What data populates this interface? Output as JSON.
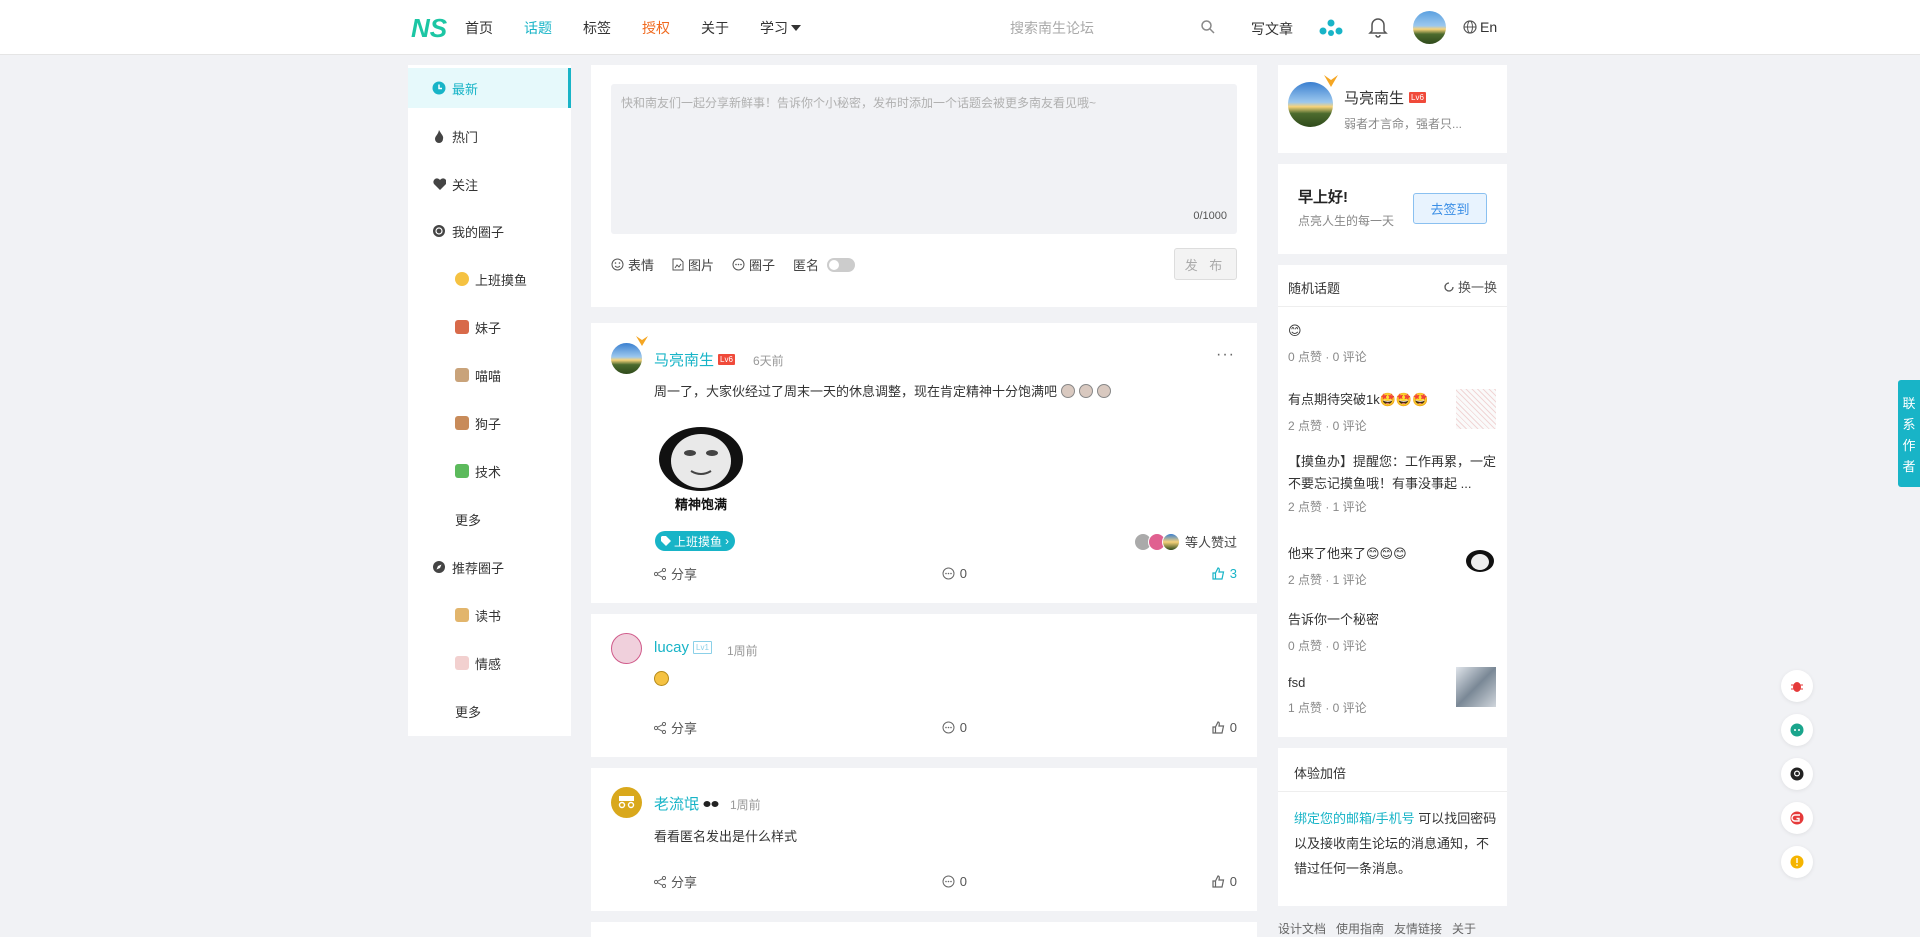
{
  "header": {
    "nav": [
      "首页",
      "话题",
      "标签",
      "授权",
      "关于",
      "学习"
    ],
    "search_placeholder": "搜索南生论坛",
    "write_label": "写文章",
    "lang_label": "En"
  },
  "sidebar": {
    "items": [
      {
        "label": "最新",
        "icon": "clock-icon"
      },
      {
        "label": "热门",
        "icon": "flame-icon"
      },
      {
        "label": "关注",
        "icon": "heart-icon"
      },
      {
        "label": "我的圈子",
        "icon": "circle-group-icon"
      },
      {
        "label": "上班摸鱼",
        "icon": "smiley-emoji"
      },
      {
        "label": "妹子",
        "icon": "girl-emoji"
      },
      {
        "label": "喵喵",
        "icon": "cat-emoji"
      },
      {
        "label": "狗子",
        "icon": "dog-emoji"
      },
      {
        "label": "技术",
        "icon": "tech-emoji"
      },
      {
        "label": "更多",
        "icon": ""
      },
      {
        "label": "推荐圈子",
        "icon": "compass-icon"
      },
      {
        "label": "读书",
        "icon": "book-emoji"
      },
      {
        "label": "情感",
        "icon": "emotion-emoji"
      },
      {
        "label": "更多",
        "icon": ""
      }
    ]
  },
  "composer": {
    "placeholder": "快和南友们一起分享新鲜事！告诉你个小秘密，发布时添加一个话题会被更多南友看见哦~",
    "counter": "0/1000",
    "tools": [
      "表情",
      "图片",
      "圈子",
      "匿名"
    ],
    "publish_label": "发 布"
  },
  "posts": [
    {
      "user": "马亮南生",
      "level": "Lv6",
      "time": "6天前",
      "text": "周一了，大家伙经过了周末一天的休息调整，现在肯定精神十分饱满吧",
      "image_caption": "精神饱满",
      "tag": "上班摸鱼",
      "liked_text": "等人赞过",
      "share": "分享",
      "comments": "0",
      "likes": "3"
    },
    {
      "user": "lucay",
      "level": "Lv1",
      "time": "1周前",
      "text": "",
      "share": "分享",
      "comments": "0",
      "likes": "0"
    },
    {
      "user": "老流氓",
      "level": "",
      "time": "1周前",
      "text": "看看匿名发出是什么样式",
      "share": "分享",
      "comments": "0",
      "likes": "0"
    }
  ],
  "profile": {
    "name": "马亮南生",
    "level": "Lv6",
    "bio": "弱者才言命，强者只..."
  },
  "checkin": {
    "greeting": "早上好!",
    "sub": "点亮人生的每一天",
    "button": "去签到"
  },
  "random_topics": {
    "title": "随机话题",
    "refresh": "换一换",
    "items": [
      {
        "title": "😊",
        "meta": "0 点赞 · 0 评论"
      },
      {
        "title": "有点期待突破1k🤩🤩🤩",
        "meta": "2 点赞 · 0 评论"
      },
      {
        "title": "【摸鱼办】提醒您：工作再累，一定不要忘记摸鱼哦！有事没事起 ...",
        "meta": "2 点赞 · 1 评论"
      },
      {
        "title": "他来了他来了😊😊😊",
        "meta": "2 点赞 · 1 评论"
      },
      {
        "title": "告诉你一个秘密",
        "meta": "0 点赞 · 0 评论"
      },
      {
        "title": "fsd",
        "meta": "1 点赞 · 0 评论"
      }
    ]
  },
  "experience": {
    "title": "体验加倍",
    "link": "绑定您的邮箱/手机号",
    "text": " 可以找回密码以及接收南生论坛的消息通知，不错过任何一条消息。"
  },
  "footer_links": [
    "设计文档",
    "使用指南",
    "友情链接",
    "关于"
  ],
  "contact_tab": "联系作者",
  "colors": {
    "accent": "#18b4c7",
    "orange": "#f06a1f",
    "level_red": "#f04a3a"
  }
}
